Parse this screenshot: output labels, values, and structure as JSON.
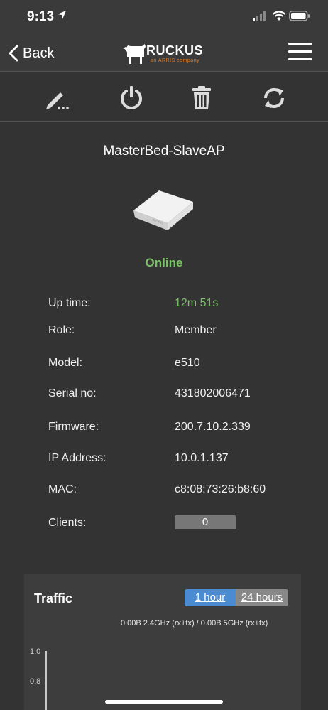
{
  "status_bar": {
    "time": "9:13"
  },
  "nav": {
    "back_label": "Back",
    "logo_text": "RUCKUS",
    "logo_sub": "an ARRIS company"
  },
  "toolbar": {
    "icons": [
      "edit-icon",
      "restart-icon",
      "delete-icon",
      "refresh-icon"
    ]
  },
  "device": {
    "name": "MasterBed-SlaveAP",
    "status": "Online"
  },
  "details": [
    {
      "label": "Up time:",
      "value": "12m 51s"
    },
    {
      "label": "Role:",
      "value": "Member"
    },
    {
      "label": "Model:",
      "value": "e510"
    },
    {
      "label": "Serial no:",
      "value": "431802006471"
    },
    {
      "label": "Firmware:",
      "value": "200.7.10.2.339"
    },
    {
      "label": "IP Address:",
      "value": "10.0.1.137"
    },
    {
      "label": "MAC:",
      "value": "c8:08:73:26:b8:60"
    },
    {
      "label": "Clients:",
      "value": "0"
    }
  ],
  "traffic": {
    "title": "Traffic",
    "range_1h": "1 hour",
    "range_24h": "24 hours",
    "selected": "1 hour",
    "legend": "0.00B 2.4GHz (rx+tx) / 0.00B 5GHz (rx+tx)",
    "y_ticks": [
      "1.0",
      "0.8"
    ]
  },
  "colors": {
    "accent": "#4a8bd1",
    "online": "#7cc06a",
    "background": "#333333"
  }
}
